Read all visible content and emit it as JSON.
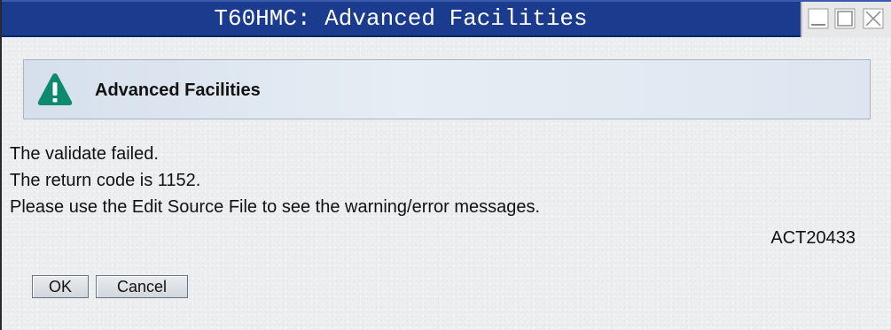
{
  "window": {
    "title": "T60HMC: Advanced Facilities",
    "controls": [
      "minimize-icon",
      "maximize-icon",
      "close-icon"
    ]
  },
  "header": {
    "icon": "warning-icon",
    "title": "Advanced Facilities"
  },
  "message": {
    "lines": [
      "The validate failed.",
      "The return code is 1152.",
      "Please use the Edit Source File to see the warning/error messages."
    ],
    "code": "ACT20433"
  },
  "buttons": {
    "ok_label": "OK",
    "cancel_label": "Cancel"
  },
  "colors": {
    "titlebar": "#1b3b8f",
    "warning_icon": "#0e8a6e"
  }
}
